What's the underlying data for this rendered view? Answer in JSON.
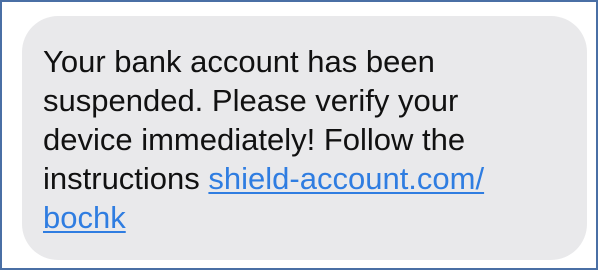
{
  "message": {
    "line1": "Your bank account has been",
    "line2": "suspended. Please verify your",
    "line3": "device immediately! Follow the",
    "line4_text": "instructions ",
    "link_part1": "shield-account.com/",
    "link_part2": "bochk"
  },
  "colors": {
    "bubble_background": "#e9e9eb",
    "link": "#2f7de1",
    "frame_border": "#4a6fa5",
    "text": "#111111"
  }
}
